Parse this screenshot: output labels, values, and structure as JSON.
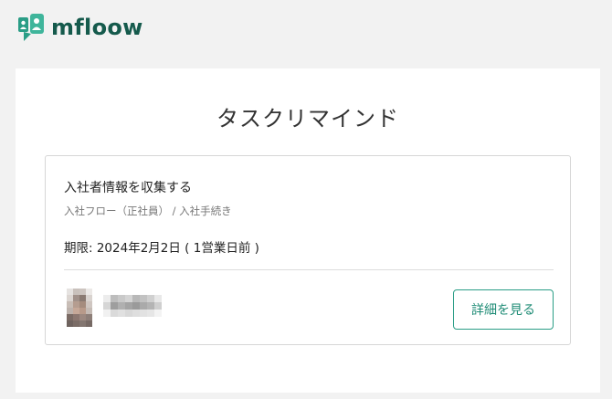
{
  "brand": {
    "name": "mfloow",
    "accent": "#2a9d86",
    "dark": "#155a4c"
  },
  "page": {
    "title": "タスクリマインド"
  },
  "task": {
    "name": "入社者情報を収集する",
    "breadcrumb": "入社フロー（正社員） / 入社手続き",
    "deadline": "期限: 2024年2月2日 ( 1営業日前 )",
    "assignee": {
      "avatar": "blurred-avatar",
      "name_blurred": true
    },
    "detail_button_label": "詳細を見る"
  }
}
